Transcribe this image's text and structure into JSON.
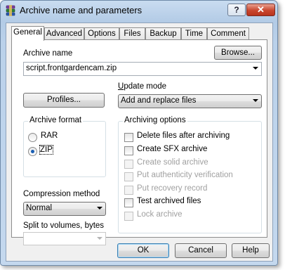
{
  "window": {
    "title": "Archive name and parameters",
    "help_caption": "?",
    "close_caption": "✕"
  },
  "tabs": [
    "General",
    "Advanced",
    "Options",
    "Files",
    "Backup",
    "Time",
    "Comment"
  ],
  "active_tab": "General",
  "archive_name": {
    "label": "Archive name",
    "value": "script.frontgardencam.zip",
    "browse_label": "Browse..."
  },
  "profiles_label": "Profiles...",
  "update_mode": {
    "label": "Update mode",
    "selected": "Add and replace files"
  },
  "archive_format": {
    "title": "Archive format",
    "options": [
      {
        "label": "RAR",
        "checked": false
      },
      {
        "label": "ZIP",
        "checked": true
      }
    ]
  },
  "compression_method": {
    "label": "Compression method",
    "selected": "Normal"
  },
  "split_volumes": {
    "label": "Split to volumes, bytes",
    "value": ""
  },
  "archiving_options": {
    "title": "Archiving options",
    "items": [
      {
        "label": "Delete files after archiving",
        "checked": false,
        "enabled": true
      },
      {
        "label": "Create SFX archive",
        "checked": false,
        "enabled": true
      },
      {
        "label": "Create solid archive",
        "checked": false,
        "enabled": false
      },
      {
        "label": "Put authenticity verification",
        "checked": false,
        "enabled": false
      },
      {
        "label": "Put recovery record",
        "checked": false,
        "enabled": false
      },
      {
        "label": "Test archived files",
        "checked": false,
        "enabled": true
      },
      {
        "label": "Lock archive",
        "checked": false,
        "enabled": false
      }
    ]
  },
  "footer": {
    "ok": "OK",
    "cancel": "Cancel",
    "help": "Help"
  },
  "colors": {
    "title_gradient_top": "#c9dcf0",
    "close_button": "#c9472f",
    "radio_dot": "#1a5fb4"
  }
}
